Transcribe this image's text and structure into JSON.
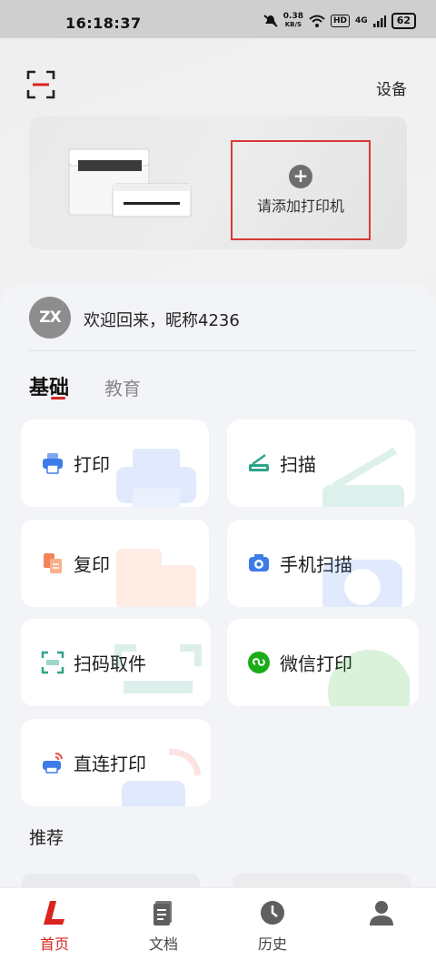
{
  "status_bar": {
    "time": "16:18:37",
    "speed_value": "0.38",
    "speed_unit": "KB/S",
    "hd": "HD",
    "network": "4G",
    "battery": "62"
  },
  "header": {
    "settings_label": "设备",
    "add_printer_label": "请添加打印机"
  },
  "user": {
    "avatar_text": "ZX",
    "welcome": "欢迎回来，昵称4236"
  },
  "tabs": [
    {
      "label": "基础",
      "active": true
    },
    {
      "label": "教育",
      "active": false
    }
  ],
  "features": {
    "print": "打印",
    "scan": "扫描",
    "copy": "复印",
    "phone_scan": "手机扫描",
    "qr_pickup": "扫码取件",
    "wechat_print": "微信打印",
    "direct_print": "直连打印"
  },
  "recommend_title": "推荐",
  "bottom_nav": [
    {
      "label": "首页",
      "icon": "home-logo-icon",
      "active": true
    },
    {
      "label": "文档",
      "icon": "document-icon",
      "active": false
    },
    {
      "label": "历史",
      "icon": "clock-icon",
      "active": false
    },
    {
      "label": "我的",
      "icon": "user-icon",
      "active": false
    }
  ],
  "colors": {
    "accent": "#d9241f",
    "print_icon": "#3d7be8",
    "scan_icon": "#2fa38a",
    "copy_icon": "#f0855a",
    "wechat": "#1aad19"
  }
}
